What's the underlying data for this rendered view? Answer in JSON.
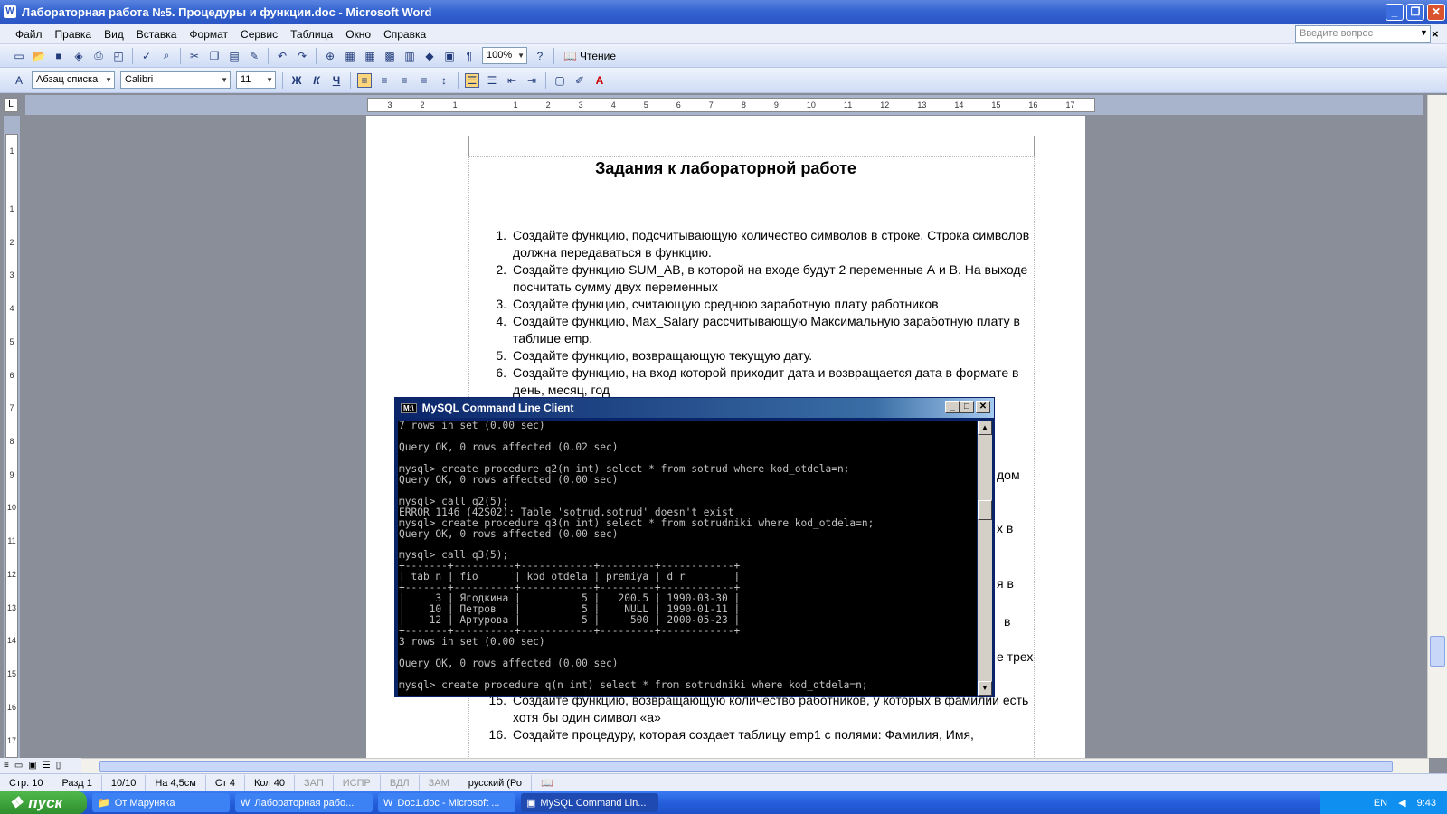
{
  "window": {
    "title": "Лабораторная работа №5. Процедуры и функции.doc - Microsoft Word",
    "icon": "W",
    "min": "_",
    "restore": "❐",
    "close": "✕"
  },
  "menu": [
    "Файл",
    "Правка",
    "Вид",
    "Вставка",
    "Формат",
    "Сервис",
    "Таблица",
    "Окно",
    "Справка"
  ],
  "help": {
    "placeholder": "Введите вопрос",
    "close": "×"
  },
  "toolbar1": {
    "zoom": "100%",
    "reading": "Чтение"
  },
  "toolbar2": {
    "style": "Абзац списка",
    "font": "Calibri",
    "size": "11",
    "bold": "Ж",
    "italic": "К",
    "underline": "Ч"
  },
  "ruler_h": [
    "3",
    "2",
    "1",
    "",
    "1",
    "2",
    "3",
    "4",
    "5",
    "6",
    "7",
    "8",
    "9",
    "10",
    "11",
    "12",
    "13",
    "14",
    "15",
    "16",
    "17"
  ],
  "ruler_v": [
    "1",
    "",
    "1",
    "2",
    "3",
    "4",
    "5",
    "6",
    "7",
    "8",
    "9",
    "10",
    "11",
    "12",
    "13",
    "14",
    "15",
    "16",
    "17"
  ],
  "ruler_corner": "L",
  "document": {
    "heading": "Задания к лабораторной работе",
    "tasks": [
      {
        "num": "1.",
        "text": "Создайте функцию, подсчитывающую количество символов в строке. Строка символов должна передаваться в функцию."
      },
      {
        "num": "2.",
        "text": "Создайте функцию  SUM_AB, в которой на входе будут 2 переменные А и В. На выходе посчитать сумму двух переменных"
      },
      {
        "num": "3.",
        "text": "Создайте функцию, считающую среднюю заработную плату работников"
      },
      {
        "num": "4.",
        "text": "Создайте функцию, Max_Salary рассчитывающую Максимальную заработную плату в таблице emp."
      },
      {
        "num": "5.",
        "text": "Создайте функцию, возвращающую текущую дату."
      },
      {
        "num": "6.",
        "text": "Создайте функцию, на вход которой приходит дата и возвращается дата в формате в день, месяц, год"
      }
    ],
    "fragments": [
      "дом",
      "х в",
      "я в",
      "в",
      "е трех"
    ],
    "tasks_bottom": [
      {
        "num": "15.",
        "text": "Создайте функцию, возвращающую количество работников, у которых в фамилии есть хотя бы один символ «а»"
      },
      {
        "num": "16.",
        "text": "Создайте процедуру, которая создает таблицу emp1  с полями: Фамилия, Имя,"
      }
    ]
  },
  "console": {
    "title": "MySQL Command Line Client",
    "icon": "M:\\",
    "lines": [
      "7 rows in set (0.00 sec)",
      "",
      "Query OK, 0 rows affected (0.02 sec)",
      "",
      "mysql> create procedure q2(n int) select * from sotrud where kod_otdela=n;",
      "Query OK, 0 rows affected (0.00 sec)",
      "",
      "mysql> call q2(5);",
      "ERROR 1146 (42S02): Table 'sotrud.sotrud' doesn't exist",
      "mysql> create procedure q3(n int) select * from sotrudniki where kod_otdela=n;",
      "Query OK, 0 rows affected (0.00 sec)",
      "",
      "mysql> call q3(5);",
      "+-------+----------+------------+---------+------------+",
      "| tab_n | fio      | kod_otdela | premiya | d_r        |",
      "+-------+----------+------------+---------+------------+",
      "|     3 | Ягодкина |          5 |   200.5 | 1990-03-30 |",
      "|    10 | Петров   |          5 |    NULL | 1990-01-11 |",
      "|    12 | Артурова |          5 |     500 | 2000-05-23 |",
      "+-------+----------+------------+---------+------------+",
      "3 rows in set (0.00 sec)",
      "",
      "Query OK, 0 rows affected (0.00 sec)",
      "",
      "mysql> create procedure q(n int) select * from sotrudniki where kod_otdela=n;"
    ]
  },
  "status": [
    "Стр. 10",
    "Разд 1",
    "10/10",
    "На 4,5см",
    "Ст 4",
    "Кол 40",
    "ЗАП",
    "ИСПР",
    "ВДЛ",
    "ЗАМ",
    "русский (Ро"
  ],
  "taskbar": {
    "start": "пуск",
    "items": [
      "От Маруняка",
      "Лабораторная рабо...",
      "Doc1.doc - Microsoft ...",
      "MySQL Command Lin..."
    ],
    "lang": "EN",
    "time": "9:43"
  }
}
